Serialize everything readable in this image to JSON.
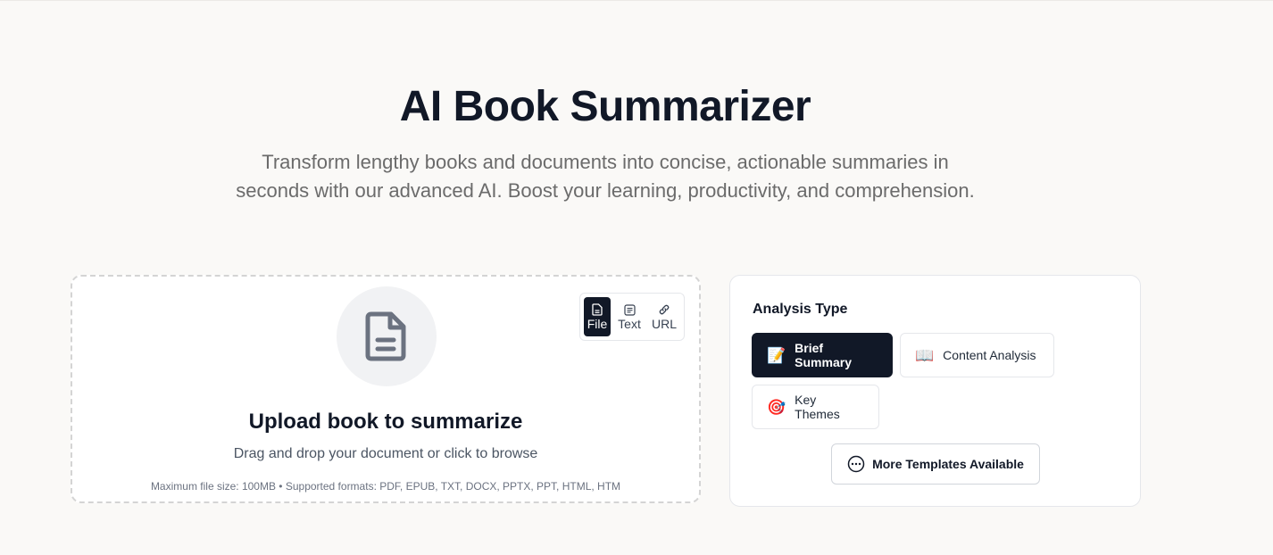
{
  "hero": {
    "title": "AI Book Summarizer",
    "subtitle": "Transform lengthy books and documents into concise, actionable summaries in seconds with our advanced AI. Boost your learning, productivity, and comprehension."
  },
  "upload": {
    "icon": "document-icon",
    "title": "Upload book to summarize",
    "description": "Drag and drop your document or click to browse",
    "note": "Maximum file size: 100MB • Supported formats: PDF, EPUB, TXT, DOCX, PPTX, PPT, HTML, HTM",
    "modes": [
      {
        "label": "File",
        "icon": "file-icon",
        "active": true
      },
      {
        "label": "Text",
        "icon": "text-icon",
        "active": false
      },
      {
        "label": "URL",
        "icon": "link-icon",
        "active": false
      }
    ]
  },
  "analysis": {
    "title": "Analysis Type",
    "options": [
      {
        "emoji": "📝",
        "label": "Brief Summary",
        "active": true
      },
      {
        "emoji": "📖",
        "label": "Content Analysis",
        "active": false
      },
      {
        "emoji": "🎯",
        "label": "Key Themes",
        "active": false
      }
    ],
    "more_label": "More Templates Available",
    "more_icon": "more-dots-icon"
  },
  "colors": {
    "background": "#faf9f7",
    "accent": "#111827",
    "muted_text": "#6b6b6b"
  }
}
